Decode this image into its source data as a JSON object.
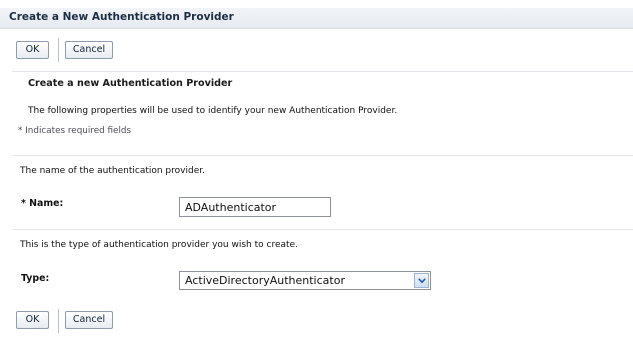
{
  "header": {
    "title": "Create a New Authentication Provider"
  },
  "top_actions": {
    "ok_label": "OK",
    "cancel_label": "Cancel"
  },
  "section": {
    "heading": "Create a new Authentication Provider",
    "description": "The following properties will be used to identify your new Authentication Provider.",
    "required_note": "* Indicates required fields"
  },
  "name_field": {
    "description": "The name of the authentication provider.",
    "required_marker": "*",
    "label": "Name:",
    "value": "ADAuthenticator"
  },
  "type_field": {
    "description": "This is the type of authentication provider you wish to create.",
    "label": "Type:",
    "selected": "ActiveDirectoryAuthenticator"
  },
  "bottom_actions": {
    "ok_label": "OK",
    "cancel_label": "Cancel"
  },
  "icons": {
    "dropdown": "chevron-down-icon"
  }
}
